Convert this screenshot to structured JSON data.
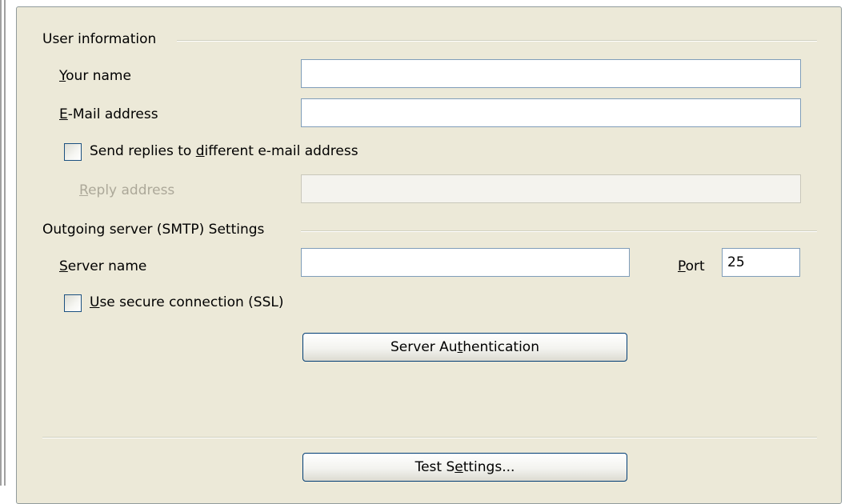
{
  "user_info": {
    "section_title": "User information",
    "your_name": {
      "label_accel": "Y",
      "label_rest": "our name",
      "value": ""
    },
    "email": {
      "label_accel": "E",
      "label_rest": "-Mail address",
      "value": ""
    },
    "send_replies": {
      "label_pre": "Send replies to ",
      "label_accel": "d",
      "label_post": "ifferent e-mail address",
      "checked": false
    },
    "reply_address": {
      "label_accel": "R",
      "label_rest": "eply address",
      "value": ""
    }
  },
  "smtp": {
    "section_title": "Outgoing server (SMTP) Settings",
    "server_name": {
      "label_accel": "S",
      "label_rest": "erver name",
      "value": ""
    },
    "port": {
      "label_accel": "P",
      "label_rest": "ort",
      "value": "25"
    },
    "ssl": {
      "label_accel": "U",
      "label_rest": "se secure connection (SSL)",
      "checked": false
    },
    "auth_button": {
      "label_pre": "Server Au",
      "label_accel": "t",
      "label_post": "hentication"
    }
  },
  "test_button": {
    "label_pre": "Test S",
    "label_accel": "e",
    "label_post": "ttings..."
  }
}
